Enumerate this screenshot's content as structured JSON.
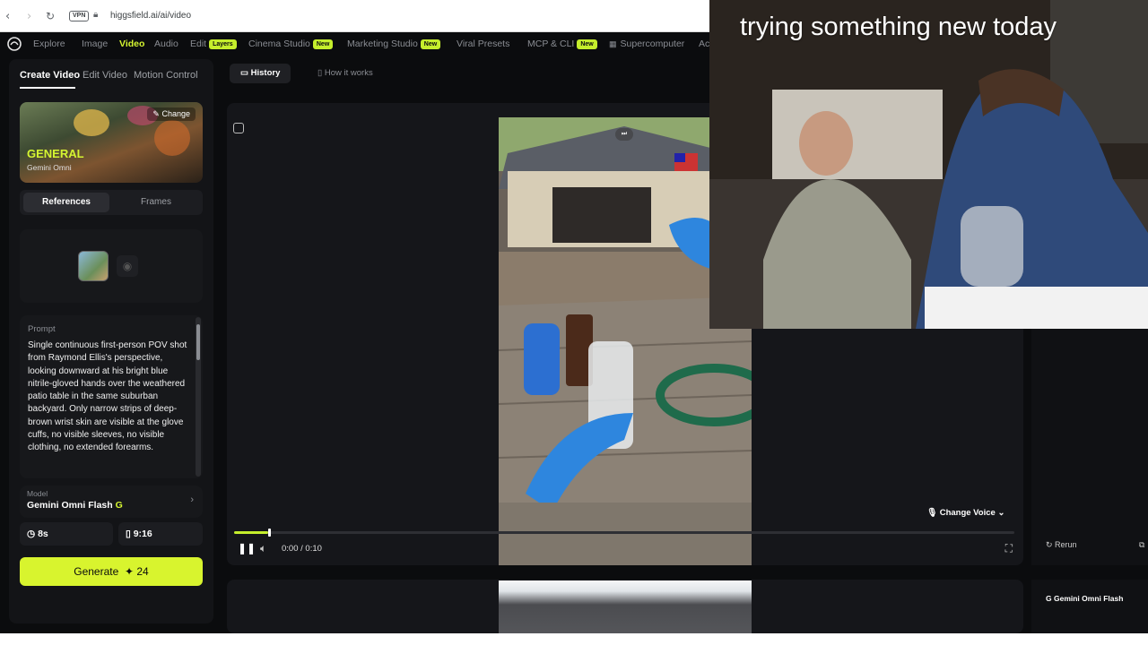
{
  "browser": {
    "back": "‹",
    "forward": "›",
    "reload": "↻",
    "vpn": "VPN",
    "url": "higgsfield.ai/ai/video"
  },
  "nav": {
    "items": [
      {
        "label": "Explore"
      },
      {
        "label": "Image"
      },
      {
        "label": "Video",
        "active": true
      },
      {
        "label": "Audio"
      },
      {
        "label": "Edit",
        "badge": "Layers"
      },
      {
        "label": "Cinema Studio",
        "badge": "New"
      },
      {
        "label": "Marketing Studio",
        "badge": "New"
      },
      {
        "label": "Viral Presets"
      },
      {
        "label": "MCP & CLI",
        "badge": "New"
      },
      {
        "label": "Supercomputer"
      },
      {
        "label": "Ac"
      }
    ]
  },
  "left": {
    "tabs": [
      "Create Video",
      "Edit Video",
      "Motion Control"
    ],
    "card": {
      "change": "Change",
      "title": "GENERAL",
      "subtitle": "Gemini Omni"
    },
    "segments": [
      "References",
      "Frames"
    ],
    "prompt": {
      "label": "Prompt",
      "text": "Single continuous first-person POV shot from Raymond Ellis's perspective, looking downward at his bright blue nitrile-gloved hands over the weathered patio table in the same suburban backyard. Only narrow strips of deep-brown wrist skin are visible at the glove cuffs, no visible sleeves, no visible clothing, no extended forearms."
    },
    "model": {
      "label": "Model",
      "name": "Gemini Omni Flash",
      "badge": "G"
    },
    "duration": "8s",
    "aspect": "9:16",
    "generate": {
      "label": "Generate",
      "cost": "24"
    }
  },
  "main": {
    "subtabs": [
      "History",
      "How it works"
    ],
    "player": {
      "time": "0:00 / 0:10",
      "progress": 0.044,
      "change_voice": "Change Voice"
    },
    "rerun": "Rerun",
    "model_chip": "Gemini Omni Flash"
  },
  "webcam": {
    "caption": "trying something new today"
  },
  "colors": {
    "accent": "#d5f531",
    "background": "#0b0c0e",
    "panel": "#131417"
  }
}
